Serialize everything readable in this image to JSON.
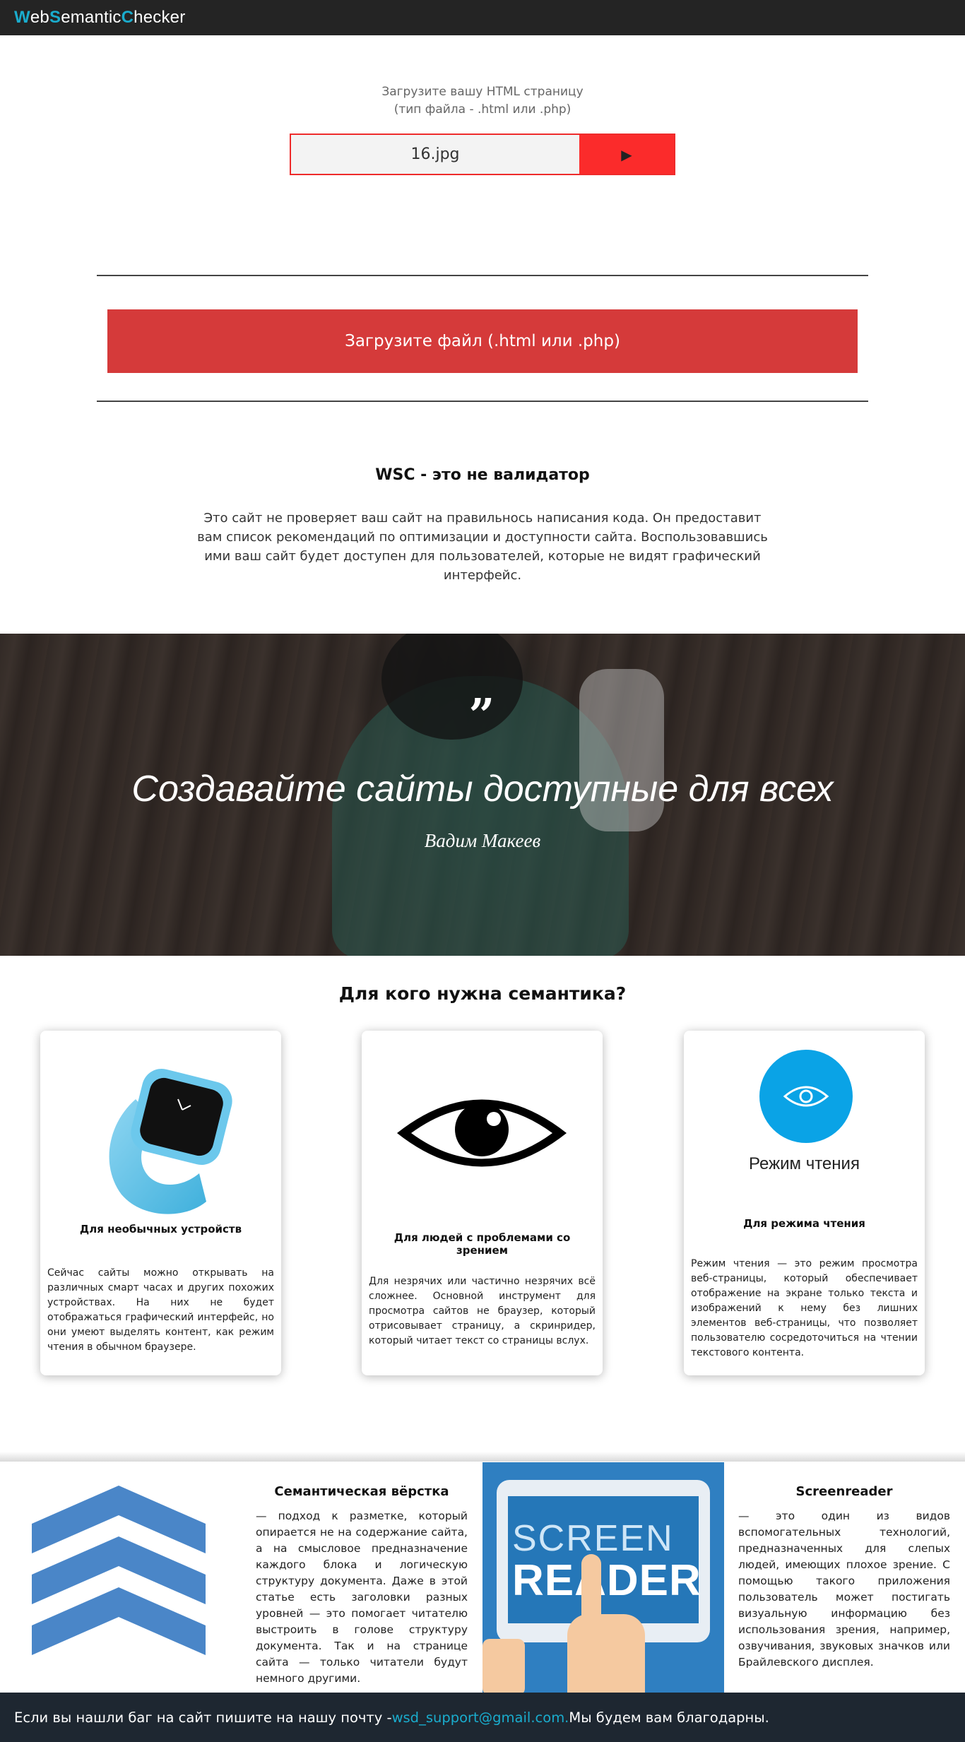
{
  "header": {
    "logo_parts": [
      "W",
      "eb",
      "S",
      "emantic",
      "C",
      "hecker"
    ]
  },
  "upload": {
    "hint_line1": "Загрузите вашу HTML страницу",
    "hint_line2": "(тип файла - .html или .php)",
    "file_name": "16.jpg",
    "submit_icon": "▶",
    "big_button_label": "Загрузите файл (.html или .php)"
  },
  "wsc": {
    "title": "WSC - это не валидатор",
    "text": "Это сайт не проверяет ваш сайт на правильнось написания кода. Он предоставит вам список рекомендаций по оптимизации и доступности сайта. Воспользовавшись ими ваш сайт будет доступен для пользователей, которые не видят графический интерфейс."
  },
  "quote": {
    "mark": "„",
    "text": "Создавайте сайты доступные для всех",
    "author": "Вадим Макеев"
  },
  "who": {
    "title": "Для кого нужна семантика?",
    "cards": [
      {
        "title": "Для необычных устройств",
        "text": "Сейчас сайты можно открывать на различных смарт часах и других похожих устройствах. На них не будет отображаться графический интерфейс, но они умеют выделять контент, как режим чтения в обычном браузере."
      },
      {
        "title": "Для людей с проблемами со зрением",
        "text": "Для незрячих или частично незрячих всё сложнее. Основной инструмент для просмотра сайтов не браузер, который отрисовывает страницу, а скринридер, который читает текст со страницы вслух."
      },
      {
        "title": "Для режима чтения",
        "image_label": "Режим чтения",
        "text": "Режим чтения — это режим просмотра веб-страницы, который обеспечивает отображение на экране только текста и изображений к нему без лишних элементов веб-страницы, что позволяет пользователю сосредоточиться на чтении текстового контента."
      }
    ]
  },
  "semantic": {
    "title": "Семантическая вёрстка",
    "text": "— подход к разметке, который опирается не на содержание сайта, а на смысловое предназначение каждого блока и логическую структуру документа. Даже в этой статье есть заголовки разных уровней — это помогает читателю выстроить в голове структуру документа. Так и на странице сайта — только читатели будут немного другими."
  },
  "screenreader": {
    "title": "Screenreader",
    "image_line1": "SCREEN",
    "image_line2": "READER",
    "text": "— это один из видов вспомогательных технологий, предназначенных для слепых людей, имеющих плохое зрение. С помощью такого приложения пользователь может постигать визуальную информацию без использования зрения, например, озвучивания, звуковых значков или Брайлевского дисплея."
  },
  "footer": {
    "text_before": "Если вы нашли баг на сайт пишите на нашу почту - ",
    "email": "wsd_support@gmail.com.",
    "text_after": " Мы будем вам благодарны."
  },
  "colors": {
    "accent": "#1aaccd",
    "header_bg": "#242424",
    "upload_red": "#fb2b2b",
    "button_red": "#d53a3a",
    "footer_bg": "#1e2731",
    "reading_mode_blue": "#0aa3e6"
  }
}
